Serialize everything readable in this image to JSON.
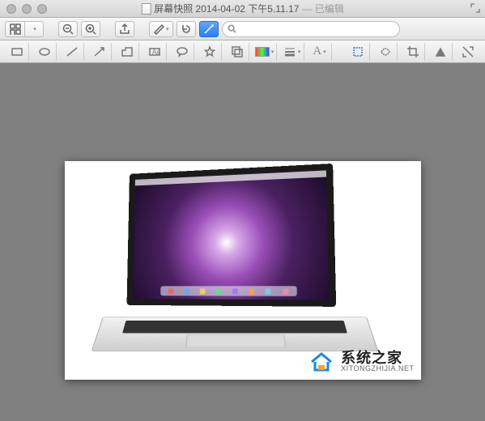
{
  "window": {
    "title": "屏幕快照 2014-04-02 下午5.11.17",
    "edited_suffix": "— 已编辑"
  },
  "toolbar1": {
    "view_mode": "view-icon",
    "zoom_out": "zoom-out",
    "zoom_in": "zoom-in",
    "share": "share",
    "highlight": "highlight",
    "rotate": "rotate",
    "markup": "markup",
    "search_placeholder": ""
  },
  "toolbar2": {
    "items": [
      "rect-icon",
      "oval-icon",
      "line-icon",
      "arrow-icon",
      "polygon-icon",
      "text-box-icon",
      "speech-icon",
      "star-icon",
      "mask-icon",
      "color-icon",
      "line-weight-icon",
      "text-style-icon",
      "rect-select-icon",
      "lasso-icon",
      "crop-icon",
      "alpha-icon",
      "adjust-icon"
    ]
  },
  "watermark": {
    "cn": "系统之家",
    "en": "XITONGZHIJIA.NET"
  }
}
